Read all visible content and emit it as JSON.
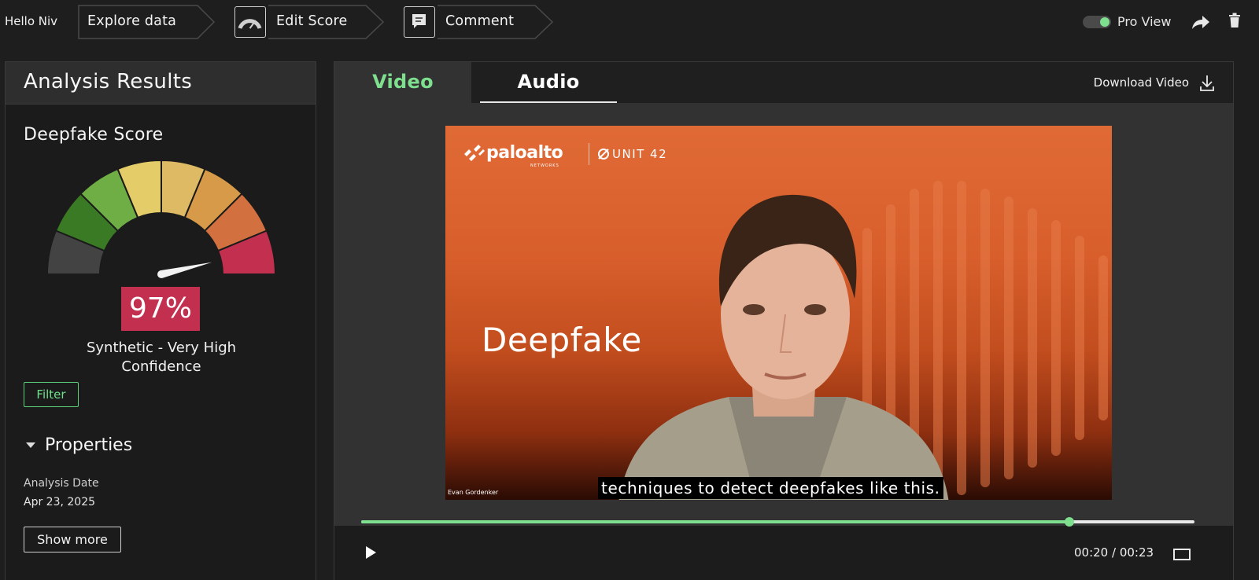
{
  "header": {
    "greeting": "Hello Niv",
    "crumbs": [
      {
        "label": "Explore data",
        "icon": ""
      },
      {
        "label": "Edit Score",
        "icon": "gauge-icon"
      },
      {
        "label": "Comment",
        "icon": "comment-icon"
      }
    ],
    "pro_view_label": "Pro View",
    "pro_view_on": true
  },
  "left_panel": {
    "title": "Analysis Results",
    "score_title": "Deepfake Score",
    "score_value": "97%",
    "score_fraction": 0.97,
    "score_label_line1": "Synthetic - Very High",
    "score_label_line2": "Confidence",
    "filter_label": "Filter",
    "properties_label": "Properties",
    "analysis_date_label": "Analysis Date",
    "analysis_date_value": "Apr 23, 2025",
    "show_more_label": "Show more",
    "gauge_colors": [
      "#434343",
      "#3b7a24",
      "#6fae45",
      "#e4cc68",
      "#dfba64",
      "#d69a48",
      "#d3703f",
      "#c3304f"
    ]
  },
  "right_panel": {
    "tabs": [
      {
        "label": "Video",
        "active": true
      },
      {
        "label": "Audio",
        "active": false
      }
    ],
    "download_label": "Download Video",
    "video": {
      "logo_text": "paloalto",
      "logo_sub": "NETWORKS",
      "logo_unit": "UNIT 42",
      "overlay_word": "Deepfake",
      "speaker_name": "Evan Gordenker",
      "subtitle": "techniques to detect deepfakes like this."
    },
    "player": {
      "time_display": "00:20 / 00:23",
      "progress_fraction": 0.8498
    }
  },
  "colors": {
    "accent_green": "#7ee08f",
    "score_red": "#c3304f"
  }
}
